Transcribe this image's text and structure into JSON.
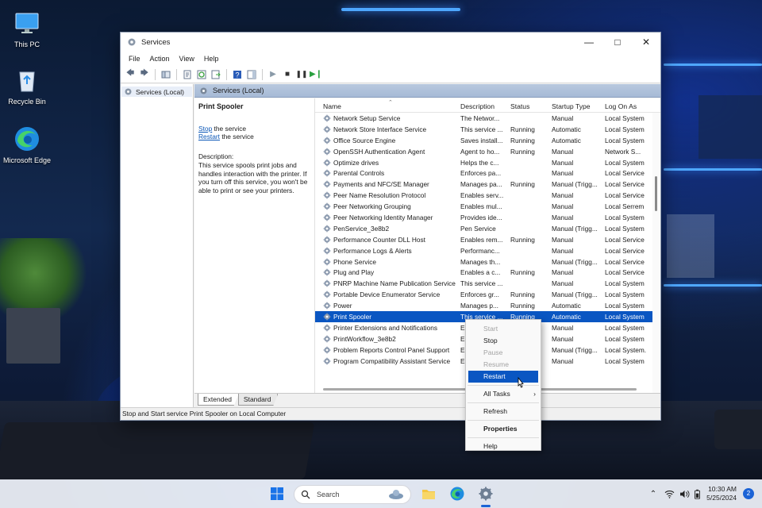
{
  "desktop": {
    "icons": [
      {
        "label": "This PC"
      },
      {
        "label": "Recycle Bin"
      },
      {
        "label": "Microsoft Edge"
      }
    ]
  },
  "window": {
    "title": "Services",
    "menu": [
      "File",
      "Action",
      "View",
      "Help"
    ],
    "tree_item": "Services (Local)",
    "panel_header": "Services (Local)",
    "description_panel": {
      "service_title": "Print Spooler",
      "stop_link": "Stop",
      "stop_suffix": " the service",
      "restart_link": "Restart",
      "restart_suffix": " the service",
      "desc_label": "Description:",
      "desc_text": "This service spools print jobs and handles interaction with the printer. If you turn off this service, you won't be able to print or see your printers."
    },
    "columns": {
      "name": "Name",
      "description": "Description",
      "status": "Status",
      "startup": "Startup Type",
      "logon": "Log On As"
    },
    "services": [
      {
        "name": "Network Setup Service",
        "desc": "The Networ...",
        "status": "",
        "startup": "Manual",
        "logon": "Local System"
      },
      {
        "name": "Network Store Interface Service",
        "desc": "This service ...",
        "status": "Running",
        "startup": "Automatic",
        "logon": "Local System"
      },
      {
        "name": "Office Source Engine",
        "desc": "Saves install...",
        "status": "Running",
        "startup": "Automatic",
        "logon": "Local System"
      },
      {
        "name": "OpenSSH Authentication Agent",
        "desc": "Agent to ho...",
        "status": "Running",
        "startup": "Manual",
        "logon": "Network S..."
      },
      {
        "name": "Optimize drives",
        "desc": "Helps the c...",
        "status": "",
        "startup": "Manual",
        "logon": "Local System"
      },
      {
        "name": "Parental Controls",
        "desc": "Enforces pa...",
        "status": "",
        "startup": "Manual",
        "logon": "Local Service"
      },
      {
        "name": "Payments and NFC/SE Manager",
        "desc": "Manages pa...",
        "status": "Running",
        "startup": "Manual (Trigg...",
        "logon": "Local Service"
      },
      {
        "name": "Peer Name Resolution Protocol",
        "desc": "Enables serv...",
        "status": "",
        "startup": "Manual",
        "logon": "Local Service"
      },
      {
        "name": "Peer Networking Grouping",
        "desc": "Enables mul...",
        "status": "",
        "startup": "Manual",
        "logon": "Local Serrem"
      },
      {
        "name": "Peer Networking Identity Manager",
        "desc": "Provides ide...",
        "status": "",
        "startup": "Manual",
        "logon": "Local System"
      },
      {
        "name": "PenService_3e8b2",
        "desc": "Pen Service",
        "status": "",
        "startup": "Manual (Trigg...",
        "logon": "Local System"
      },
      {
        "name": "Performance Counter DLL Host",
        "desc": "Enables rem...",
        "status": "Running",
        "startup": "Manual",
        "logon": "Local Service"
      },
      {
        "name": "Performance Logs & Alerts",
        "desc": "Performanc...",
        "status": "",
        "startup": "Manual",
        "logon": "Local Service"
      },
      {
        "name": "Phone Service",
        "desc": "Manages th...",
        "status": "",
        "startup": "Manual (Trigg...",
        "logon": "Local Service"
      },
      {
        "name": "Plug and Play",
        "desc": "Enables a c...",
        "status": "Running",
        "startup": "Manual",
        "logon": "Local Service"
      },
      {
        "name": "PNRP Machine Name Publication Service",
        "desc": "This service ...",
        "status": "",
        "startup": "Manual",
        "logon": "Local System"
      },
      {
        "name": "Portable Device Enumerator Service",
        "desc": "Enforces gr...",
        "status": "Running",
        "startup": "Manual (Trigg...",
        "logon": "Local System"
      },
      {
        "name": "Power",
        "desc": "Manages p...",
        "status": "Running",
        "startup": "Automatic",
        "logon": "Local System"
      },
      {
        "name": "Print Spooler",
        "desc": "This service ...",
        "status": "Running",
        "startup": "Automatic",
        "logon": "Local System",
        "selected": true
      },
      {
        "name": "Printer Extensions and Notifications",
        "desc": "E",
        "status": "",
        "startup": "Manual",
        "logon": "Local System"
      },
      {
        "name": "PrintWorkflow_3e8b2",
        "desc": "E",
        "status": "",
        "startup": "Manual",
        "logon": "Local System"
      },
      {
        "name": "Problem Reports Control Panel Support",
        "desc": "E",
        "status": "",
        "startup": "Manual (Trigg...",
        "logon": "Local System."
      },
      {
        "name": "Program Compatibility Assistant Service",
        "desc": "E",
        "status": "",
        "startup": "Manual",
        "logon": "Local System"
      }
    ],
    "tabs": [
      "Extended",
      "Standard"
    ],
    "status_bar": "Stop and Start service Print Spooler on Local Computer"
  },
  "context_menu": {
    "items": [
      {
        "label": "Start",
        "disabled": true
      },
      {
        "label": "Stop"
      },
      {
        "label": "Pause",
        "disabled": true
      },
      {
        "label": "Resume",
        "disabled": true
      },
      {
        "label": "Restart",
        "highlighted": true
      },
      {
        "sep": true
      },
      {
        "label": "All Tasks",
        "submenu": true
      },
      {
        "sep": true
      },
      {
        "label": "Refresh"
      },
      {
        "sep": true
      },
      {
        "label": "Properties",
        "bold": true
      },
      {
        "sep": true
      },
      {
        "label": "Help"
      }
    ]
  },
  "taskbar": {
    "search_placeholder": "Search",
    "time": "10:30 AM",
    "date": "5/25/2024",
    "notification_count": "2"
  },
  "colors": {
    "selection": "#0a56c2",
    "link": "#0b57b7",
    "panel_header": "#a6bad6"
  }
}
